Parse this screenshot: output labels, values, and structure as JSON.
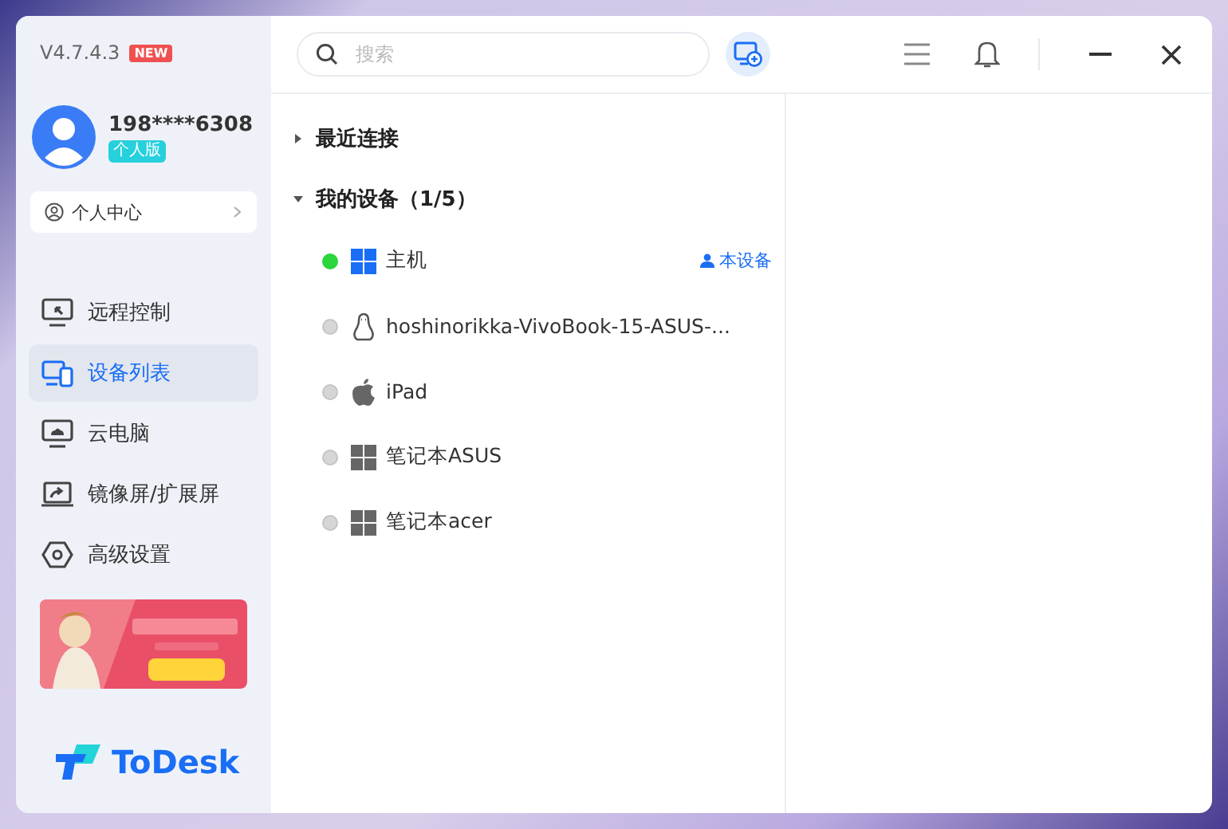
{
  "version": "V4.7.4.3",
  "version_badge": "NEW",
  "account": {
    "phone": "198****6308",
    "plan": "个人版"
  },
  "profile_link": "个人中心",
  "nav": [
    {
      "label": "远程控制",
      "kind": "remote",
      "selected": false
    },
    {
      "label": "设备列表",
      "kind": "devices",
      "selected": true
    },
    {
      "label": "云电脑",
      "kind": "cloud",
      "selected": false
    },
    {
      "label": "镜像屏/扩展屏",
      "kind": "mirror",
      "selected": false
    },
    {
      "label": "高级设置",
      "kind": "settings",
      "selected": false
    }
  ],
  "logo": "ToDesk",
  "search": {
    "placeholder": "搜索"
  },
  "groups": [
    {
      "title": "最近连接",
      "expanded": false
    },
    {
      "title": "我的设备（1/5）",
      "expanded": true,
      "devices": [
        {
          "name": "主机",
          "kind": "windows",
          "online": true,
          "tag": "本设备"
        },
        {
          "name": "hoshinorikka-VivoBook-15-ASUS-...",
          "kind": "linux",
          "online": false
        },
        {
          "name": "iPad",
          "kind": "apple",
          "online": false
        },
        {
          "name": "笔记本ASUS",
          "kind": "windows",
          "online": false
        },
        {
          "name": "笔记本acer",
          "kind": "windows",
          "online": false
        }
      ]
    }
  ]
}
